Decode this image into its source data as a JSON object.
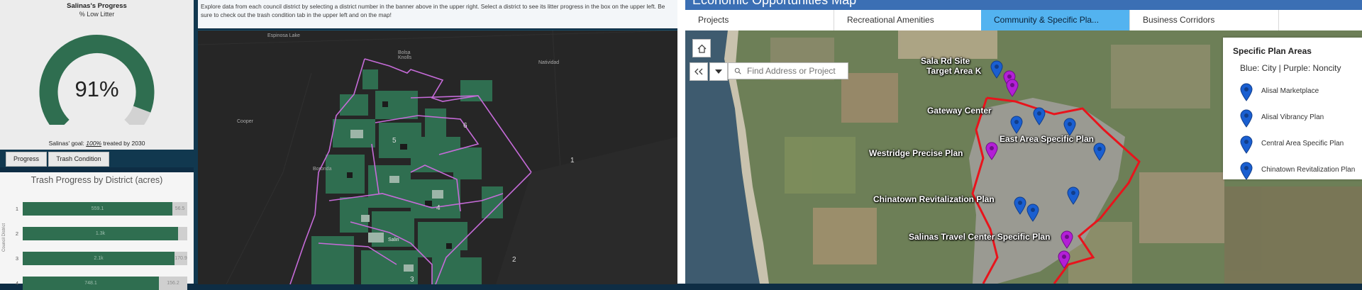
{
  "progress": {
    "title": "Salinas's Progress",
    "subtitle": "% Low Litter",
    "gauge_value": "91%",
    "gauge_fraction": 0.91,
    "goal_prefix": "Salinas' goal: ",
    "goal_pct": "100%",
    "goal_suffix": " treated by 2030",
    "colors": {
      "done": "#2f6e50",
      "rest": "#d2d2d2"
    }
  },
  "tabs": {
    "progress": "Progress",
    "trash_condition": "Trash Condition"
  },
  "trash_chart": {
    "title": "Trash Progress by District (acres)",
    "axis_label": "Council District",
    "rows": [
      {
        "district": "1",
        "done_label": "559.1",
        "rest_label": "56.5",
        "done_frac": 0.908
      },
      {
        "district": "2",
        "done_label": "1.3k",
        "rest_label": "",
        "done_frac": 0.944
      },
      {
        "district": "3",
        "done_label": "2.1k",
        "rest_label": "170.9",
        "done_frac": 0.922
      },
      {
        "district": "4",
        "done_label": "748.1",
        "rest_label": "156.2",
        "done_frac": 0.827
      }
    ]
  },
  "explore": {
    "text": "Explore data from each council district by  selecting a district number in the banner above in the upper right.  Select a  district to see its litter progress in the box on the upper left.  Be sure to check out the trash condition tab in the upper left and on the map!"
  },
  "district_map": {
    "places": {
      "espinosa": "Espinosa Lake",
      "bolsa": "Bolsa Knolls",
      "natividad": "Natividad",
      "cooper": "Cooper",
      "boronda": "Boronda",
      "salinas": "Salin"
    },
    "districts": [
      "1",
      "2",
      "3",
      "4",
      "5",
      "6"
    ]
  },
  "econ": {
    "title": "Economic Opportunities Map",
    "tabs": [
      "Projects",
      "Recreational Amenities",
      "Community & Specific Pla...",
      "Business Corridors"
    ],
    "active_tab": 2,
    "search_placeholder": "Find Address or Project",
    "labels": {
      "sala": "Sala Rd Site",
      "target": "Target Area K",
      "gateway": "Gateway Center",
      "east": "East Area Specific Plan",
      "westridge": "Westridge Precise Plan",
      "chinatown": "Chinatown Revitalization Plan",
      "travel": "Salinas Travel Center Specific Plan"
    },
    "legend": {
      "title": "Specific Plan Areas",
      "subtitle": "Blue: City | Purple: Noncity",
      "items": [
        "Alisal Marketplace",
        "Alisal Vibrancy Plan",
        "Central Area Specific Plan",
        "Chinatown Revitalization Plan"
      ]
    },
    "colors": {
      "city_pin": "#1a5fd1",
      "noncity_pin": "#b31fd6",
      "boundary": "#e8141c"
    }
  }
}
